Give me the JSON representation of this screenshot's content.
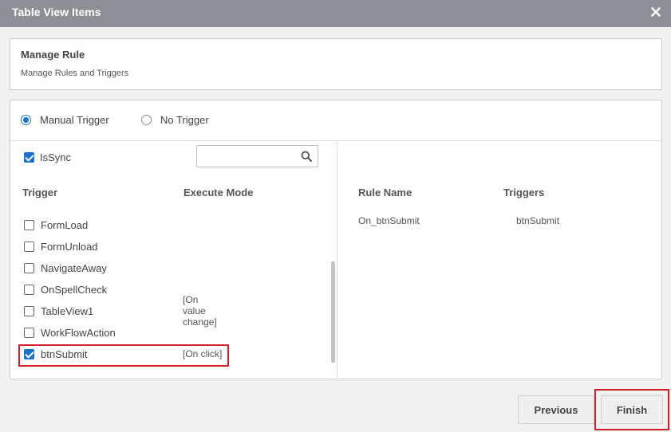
{
  "dialog": {
    "title": "Table View Items"
  },
  "manage_rule": {
    "heading": "Manage Rule",
    "subheading": "Manage Rules and Triggers"
  },
  "trigger_type": {
    "options": [
      {
        "label": "Manual Trigger",
        "selected": true
      },
      {
        "label": "No Trigger",
        "selected": false
      }
    ]
  },
  "issync": {
    "label": "IsSync",
    "checked": true
  },
  "search": {
    "value": "",
    "placeholder": ""
  },
  "trigger_table": {
    "headers": {
      "trigger": "Trigger",
      "mode": "Execute Mode"
    },
    "rows": [
      {
        "name": "FormLoad",
        "checked": false,
        "mode": ""
      },
      {
        "name": "FormUnload",
        "checked": false,
        "mode": ""
      },
      {
        "name": "NavigateAway",
        "checked": false,
        "mode": ""
      },
      {
        "name": "OnSpellCheck",
        "checked": false,
        "mode": ""
      },
      {
        "name": "TableView1",
        "checked": false,
        "mode": "[On value change]"
      },
      {
        "name": "WorkFlowAction",
        "checked": false,
        "mode": ""
      },
      {
        "name": "btnSubmit",
        "checked": true,
        "mode": "[On click]",
        "highlighted": true
      }
    ]
  },
  "rule_table": {
    "headers": {
      "rule_name": "Rule Name",
      "triggers": "Triggers"
    },
    "rows": [
      {
        "rule_name": "On_btnSubmit",
        "triggers": "btnSubmit"
      }
    ]
  },
  "footer": {
    "previous_label": "Previous",
    "finish_label": "Finish"
  },
  "colors": {
    "titlebar": "#8d8f96",
    "accent": "#1a73c8",
    "highlight": "#d32028"
  },
  "icons": {
    "close": "close-icon",
    "search": "search-icon"
  }
}
